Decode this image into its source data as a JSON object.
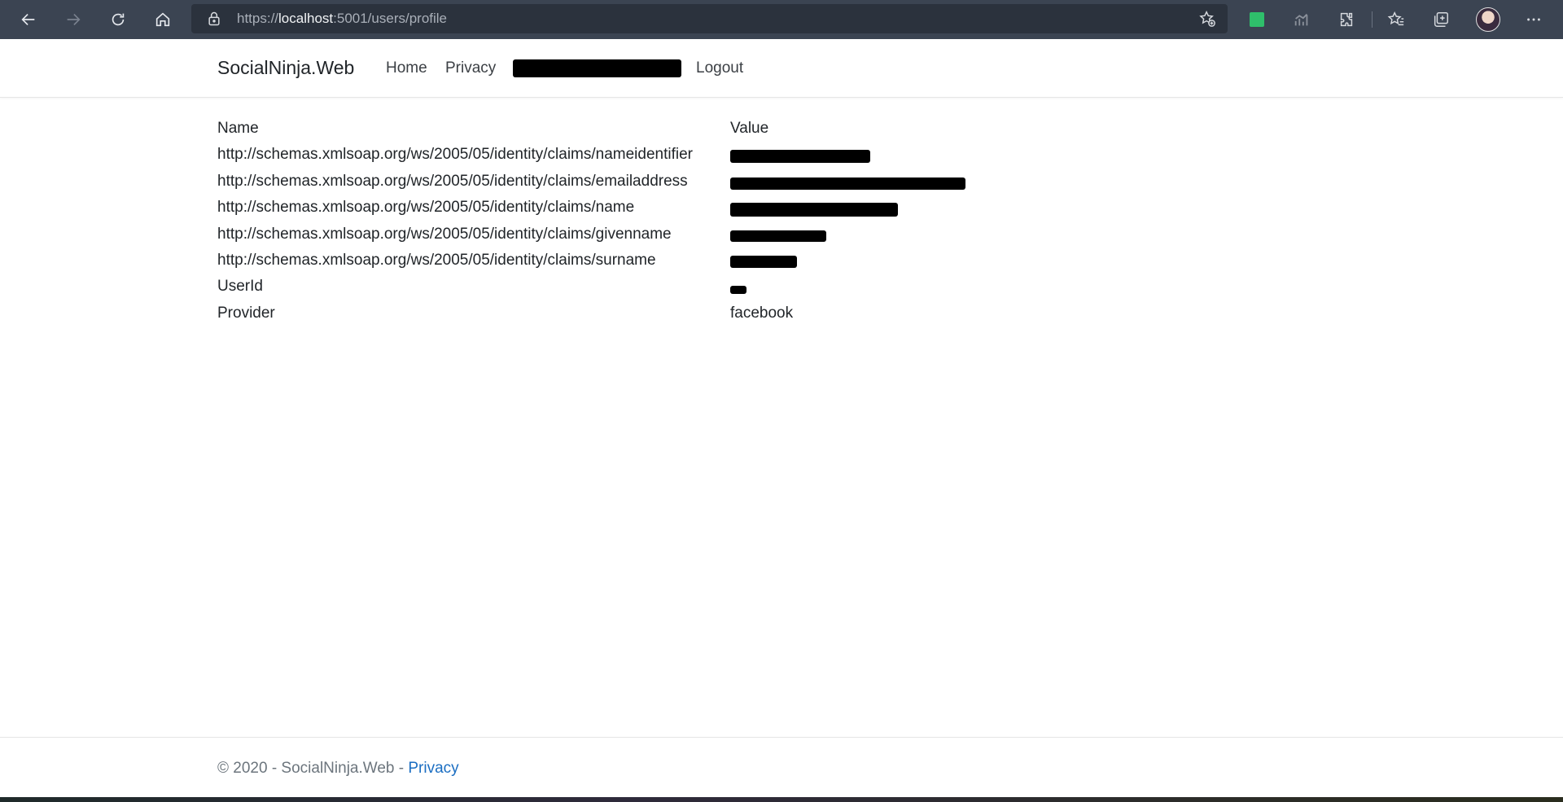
{
  "browser": {
    "url_prefix": "https://",
    "url_host": "localhost",
    "url_rest": ":5001/users/profile",
    "icons": [
      "back-icon",
      "forward-icon",
      "refresh-icon",
      "home-icon",
      "lock-icon",
      "add-favorite-icon",
      "extension-green-icon",
      "performance-icon",
      "extensions-icon",
      "favorites-icon",
      "collections-icon",
      "profile-avatar",
      "more-icon"
    ]
  },
  "navbar": {
    "brand": "SocialNinja.Web",
    "home": "Home",
    "privacy": "Privacy",
    "logout": "Logout"
  },
  "claims": {
    "header_name": "Name",
    "header_value": "Value",
    "rows": [
      {
        "name": "http://schemas.xmlsoap.org/ws/2005/05/identity/claims/nameidentifier",
        "value": ""
      },
      {
        "name": "http://schemas.xmlsoap.org/ws/2005/05/identity/claims/emailaddress",
        "value": ""
      },
      {
        "name": "http://schemas.xmlsoap.org/ws/2005/05/identity/claims/name",
        "value": ""
      },
      {
        "name": "http://schemas.xmlsoap.org/ws/2005/05/identity/claims/givenname",
        "value": ""
      },
      {
        "name": "http://schemas.xmlsoap.org/ws/2005/05/identity/claims/surname",
        "value": ""
      },
      {
        "name": "UserId",
        "value": ""
      },
      {
        "name": "Provider",
        "value": "facebook"
      }
    ]
  },
  "footer": {
    "copyright": "© 2020 - SocialNinja.Web - ",
    "privacy_link": "Privacy"
  },
  "colors": {
    "chrome_bg": "#3b4452",
    "link_blue": "#1b6ec2",
    "extension_green": "#2fbf6b"
  }
}
